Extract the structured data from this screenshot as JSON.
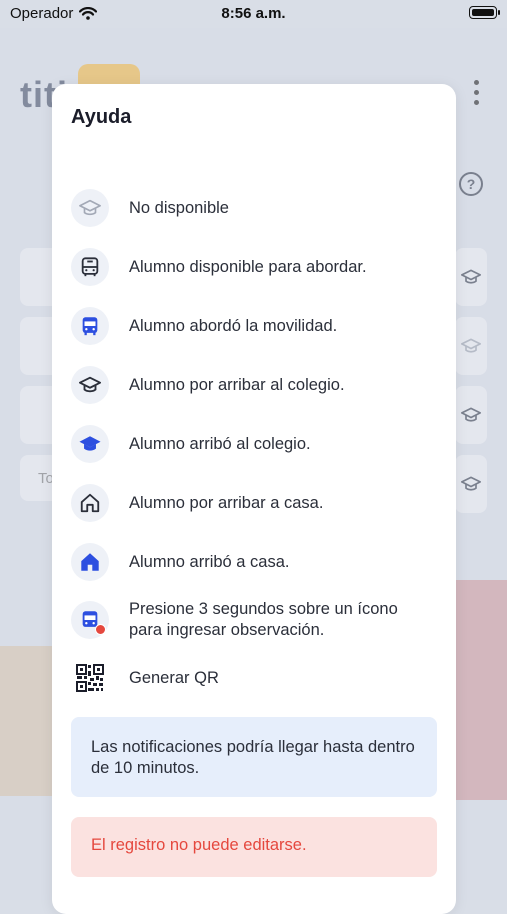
{
  "status_bar": {
    "carrier": "Operador",
    "time": "8:56 a.m."
  },
  "background": {
    "logo_text": "titi",
    "row_text": "To"
  },
  "modal": {
    "title": "Ayuda",
    "items": [
      {
        "label": "No disponible",
        "icon": "graduation-cap-grey-icon"
      },
      {
        "label": "Alumno disponible para abordar.",
        "icon": "bus-outline-icon"
      },
      {
        "label": "Alumno abordó la movilidad.",
        "icon": "bus-filled-blue-icon"
      },
      {
        "label": "Alumno por arribar al colegio.",
        "icon": "graduation-cap-outline-icon"
      },
      {
        "label": "Alumno arribó al colegio.",
        "icon": "graduation-cap-filled-blue-icon"
      },
      {
        "label": "Alumno por arribar a casa.",
        "icon": "home-outline-icon"
      },
      {
        "label": "Alumno arribó a casa.",
        "icon": "home-filled-blue-icon"
      },
      {
        "label": "Presione 3 segundos sobre un ícono para ingresar observación.",
        "icon": "bus-with-red-dot-icon"
      },
      {
        "label": "Generar QR",
        "icon": "qr-code-icon"
      }
    ],
    "info_text": "Las notificaciones podría llegar hasta dentro de 10 minutos.",
    "warning_text": "El registro no puede editarse."
  },
  "colors": {
    "accent_blue": "#2d4fe0",
    "warning_red": "#e5483e",
    "info_bg": "#e6eefb",
    "warning_bg": "#fbe2e0"
  }
}
